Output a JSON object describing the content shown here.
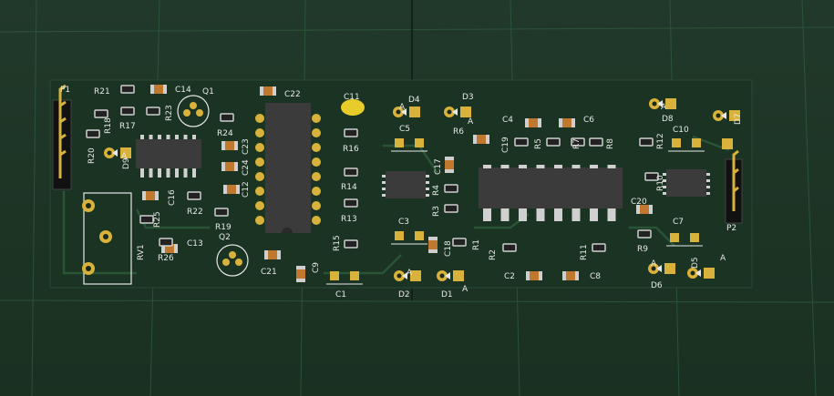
{
  "viewer": {
    "title": "",
    "colors": {
      "background": "#1e3526",
      "grid": "#2f5a3c",
      "board": "#17301f",
      "silkscreen": "#e8e8e8",
      "pad_gold": "#d8b23a",
      "ic_body": "#3b3b3b",
      "cap_tan": "#c0782e",
      "led": "#e8cc2a"
    }
  },
  "board": {
    "components": [
      {
        "ref": "P1",
        "kind": "header"
      },
      {
        "ref": "P2",
        "kind": "header"
      },
      {
        "ref": "RV1",
        "kind": "trimmer"
      },
      {
        "ref": "Q1",
        "kind": "transistor"
      },
      {
        "ref": "Q2",
        "kind": "transistor"
      },
      {
        "ref": "D1",
        "kind": "diode"
      },
      {
        "ref": "D2",
        "kind": "diode"
      },
      {
        "ref": "D3",
        "kind": "diode"
      },
      {
        "ref": "D4",
        "kind": "diode"
      },
      {
        "ref": "D5",
        "kind": "diode"
      },
      {
        "ref": "D6",
        "kind": "diode"
      },
      {
        "ref": "D7",
        "kind": "diode"
      },
      {
        "ref": "D8",
        "kind": "diode"
      },
      {
        "ref": "D9",
        "kind": "diode"
      },
      {
        "ref": "C1",
        "kind": "cap"
      },
      {
        "ref": "C2",
        "kind": "cap"
      },
      {
        "ref": "C3",
        "kind": "cap"
      },
      {
        "ref": "C4",
        "kind": "cap"
      },
      {
        "ref": "C5",
        "kind": "cap"
      },
      {
        "ref": "C6",
        "kind": "cap"
      },
      {
        "ref": "C7",
        "kind": "cap"
      },
      {
        "ref": "C8",
        "kind": "cap"
      },
      {
        "ref": "C9",
        "kind": "cap"
      },
      {
        "ref": "C10",
        "kind": "cap"
      },
      {
        "ref": "C11",
        "kind": "led"
      },
      {
        "ref": "C12",
        "kind": "cap"
      },
      {
        "ref": "C13",
        "kind": "cap"
      },
      {
        "ref": "C14",
        "kind": "cap"
      },
      {
        "ref": "C16",
        "kind": "cap"
      },
      {
        "ref": "C17",
        "kind": "cap"
      },
      {
        "ref": "C18",
        "kind": "cap"
      },
      {
        "ref": "C19",
        "kind": "cap"
      },
      {
        "ref": "C20",
        "kind": "cap"
      },
      {
        "ref": "C21",
        "kind": "cap"
      },
      {
        "ref": "C22",
        "kind": "cap"
      },
      {
        "ref": "C23",
        "kind": "cap"
      },
      {
        "ref": "C24",
        "kind": "cap"
      },
      {
        "ref": "R1",
        "kind": "res"
      },
      {
        "ref": "R2",
        "kind": "res"
      },
      {
        "ref": "R3",
        "kind": "res"
      },
      {
        "ref": "R4",
        "kind": "res"
      },
      {
        "ref": "R5",
        "kind": "res"
      },
      {
        "ref": "R6",
        "kind": "res"
      },
      {
        "ref": "R7",
        "kind": "res"
      },
      {
        "ref": "R8",
        "kind": "res"
      },
      {
        "ref": "R9",
        "kind": "res"
      },
      {
        "ref": "R10",
        "kind": "res"
      },
      {
        "ref": "R11",
        "kind": "res"
      },
      {
        "ref": "R12",
        "kind": "res"
      },
      {
        "ref": "R13",
        "kind": "res"
      },
      {
        "ref": "R14",
        "kind": "res"
      },
      {
        "ref": "R15",
        "kind": "res"
      },
      {
        "ref": "R16",
        "kind": "res"
      },
      {
        "ref": "R17",
        "kind": "res"
      },
      {
        "ref": "R18",
        "kind": "res"
      },
      {
        "ref": "R19",
        "kind": "res"
      },
      {
        "ref": "R20",
        "kind": "res"
      },
      {
        "ref": "R21",
        "kind": "res"
      },
      {
        "ref": "R22",
        "kind": "res"
      },
      {
        "ref": "R23",
        "kind": "res"
      },
      {
        "ref": "R24",
        "kind": "res"
      },
      {
        "ref": "R25",
        "kind": "res"
      },
      {
        "ref": "R26",
        "kind": "res"
      },
      {
        "ref": "U_DIP",
        "kind": "dip"
      },
      {
        "ref": "U_SOIC_L",
        "kind": "soic"
      },
      {
        "ref": "U_SOIC_M",
        "kind": "soic"
      },
      {
        "ref": "U_SOIC_R",
        "kind": "soic"
      },
      {
        "ref": "U_BIG",
        "kind": "soic"
      }
    ],
    "anode_marker": "A"
  }
}
